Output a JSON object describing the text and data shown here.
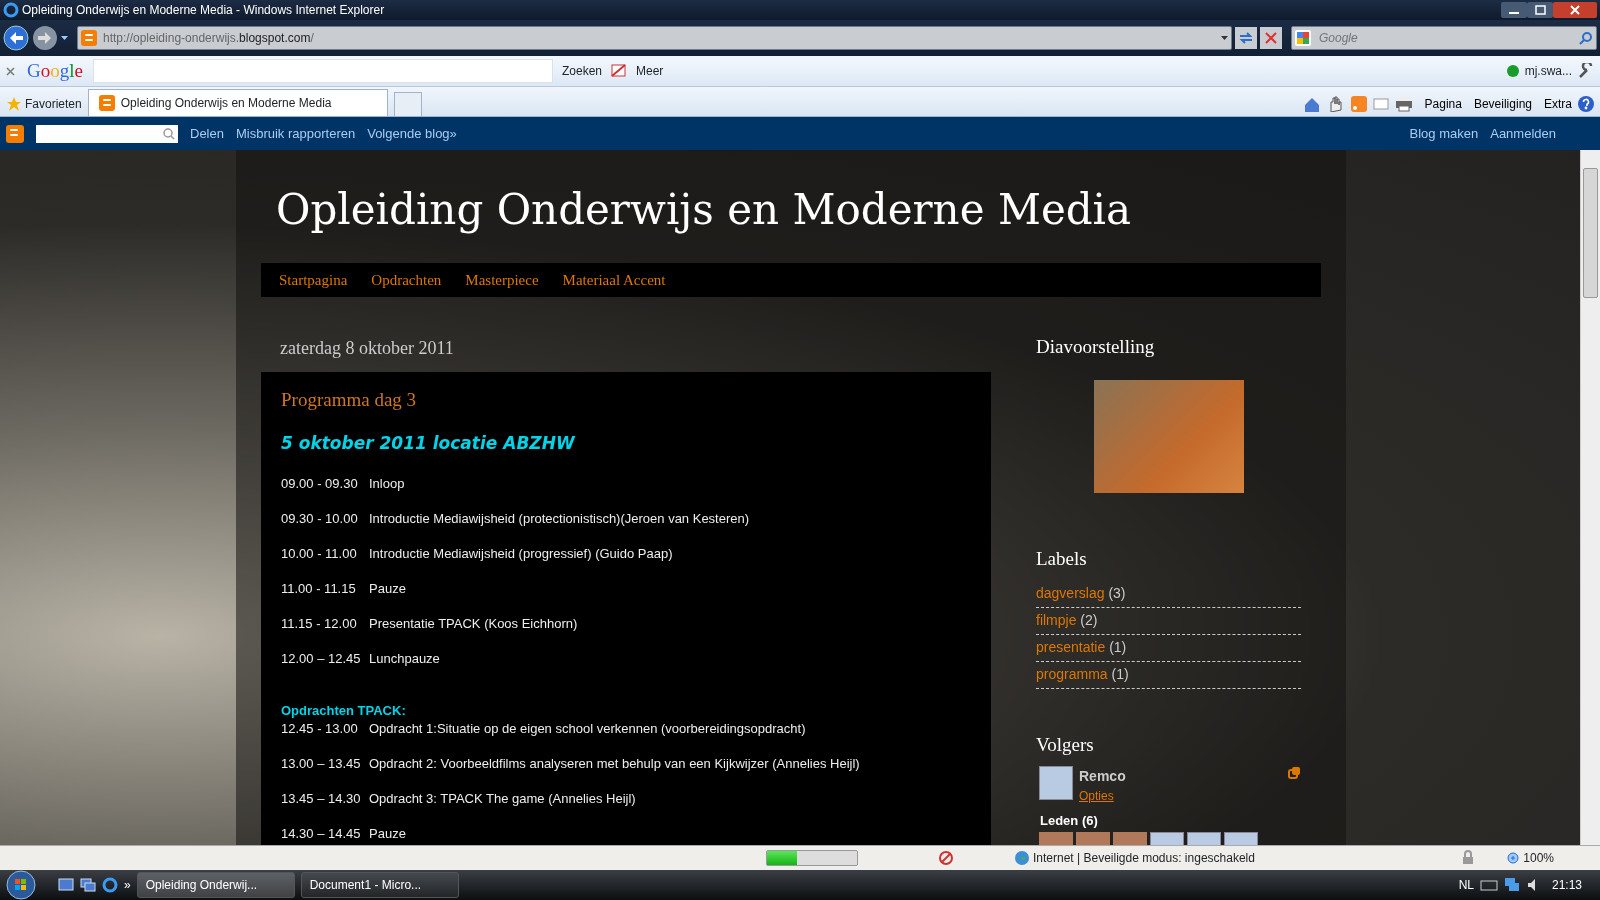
{
  "window": {
    "title": "Opleiding Onderwijs en Moderne Media - Windows Internet Explorer"
  },
  "address_bar": {
    "url_prefix": "http://opleiding-onderwijs.",
    "url_domain": "blogspot.com",
    "url_suffix": "/",
    "search_placeholder": "Google"
  },
  "google_toolbar": {
    "logo": "Google",
    "search_button": "Zoeken",
    "more": "Meer",
    "account": "mj.swa..."
  },
  "favorites_bar": {
    "favorites": "Favorieten",
    "tabs": [
      {
        "label": "Opleiding Onderwijs en Moderne Media",
        "selected": true
      }
    ],
    "commands": [
      "Pagina",
      "Beveiliging",
      "Extra"
    ]
  },
  "blogger_bar": {
    "links": [
      "Delen",
      "Misbruik rapporteren",
      "Volgende blog»"
    ],
    "right_links": [
      "Blog maken",
      "Aanmelden"
    ]
  },
  "blog": {
    "title": "Opleiding Onderwijs en Moderne Media",
    "nav": [
      "Startpagina",
      "Opdrachten",
      "Masterpiece",
      "Materiaal Accent"
    ],
    "date": "zaterdag 8 oktober 2011",
    "post": {
      "title": "Programma dag 3",
      "subtitle": "5 oktober 2011 locatie ABZHW",
      "schedule": [
        {
          "kind": "row",
          "time": "09.00 - 09.30",
          "text": "Inloop"
        },
        {
          "kind": "row",
          "time": "09.30 - 10.00",
          "text": "Introductie Mediawijsheid (protectionistisch)(Jeroen van Kesteren)"
        },
        {
          "kind": "row",
          "time": "10.00 - 11.00",
          "text": "Introductie Mediawijsheid (progressief) (Guido Paap)"
        },
        {
          "kind": "row",
          "time": "11.00 - 11.15",
          "text": "Pauze"
        },
        {
          "kind": "row",
          "time": "11.15 - 12.00",
          "text": "Presentatie TPACK (Koos Eichhorn)"
        },
        {
          "kind": "row",
          "time": "12.00 – 12.45",
          "text": "Lunchpauze"
        },
        {
          "kind": "heading",
          "text": "Opdrachten TPACK:"
        },
        {
          "kind": "row",
          "time": "12.45  - 13.00",
          "text": "Opdracht 1:Situatie op de eigen school verkennen (voorbereidingsopdracht)"
        },
        {
          "kind": "row",
          "time": "13.00 – 13.45",
          "text": "Opdracht 2: Voorbeeldfilms analyseren met behulp van een Kijkwijzer (Annelies Heijl)"
        },
        {
          "kind": "row",
          "time": "13.45 – 14.30",
          "text": "Opdracht 3: TPACK The game (Annelies Heijl)"
        },
        {
          "kind": "row",
          "time": "14.30 – 14.45",
          "text": "Pauze"
        }
      ]
    }
  },
  "sidebar": {
    "slideshow_title": "Diavoorstelling",
    "labels_title": "Labels",
    "labels": [
      {
        "name": "dagverslag",
        "count": "(3)"
      },
      {
        "name": "filmpje",
        "count": "(2)"
      },
      {
        "name": "presentatie",
        "count": "(1)"
      },
      {
        "name": "programma",
        "count": "(1)"
      }
    ],
    "followers_title": "Volgers",
    "follower": {
      "name": "Remco",
      "options": "Opties"
    },
    "members_label": "Leden (6)",
    "members": [
      {
        "kind": "photo"
      },
      {
        "kind": "photo"
      },
      {
        "kind": "photo"
      },
      {
        "kind": "silhouette"
      },
      {
        "kind": "silhouette"
      },
      {
        "kind": "silhouette"
      }
    ]
  },
  "status_bar": {
    "level": 0.33,
    "zone": "Internet | Beveiligde modus: ingeschakeld",
    "zoom": "100%"
  },
  "taskbar": {
    "more": "»",
    "buttons": [
      {
        "label": "Opleiding Onderwij...",
        "selected": true
      },
      {
        "label": "Document1 - Micro...",
        "selected": false
      }
    ],
    "language": "NL",
    "time": "21:13"
  }
}
